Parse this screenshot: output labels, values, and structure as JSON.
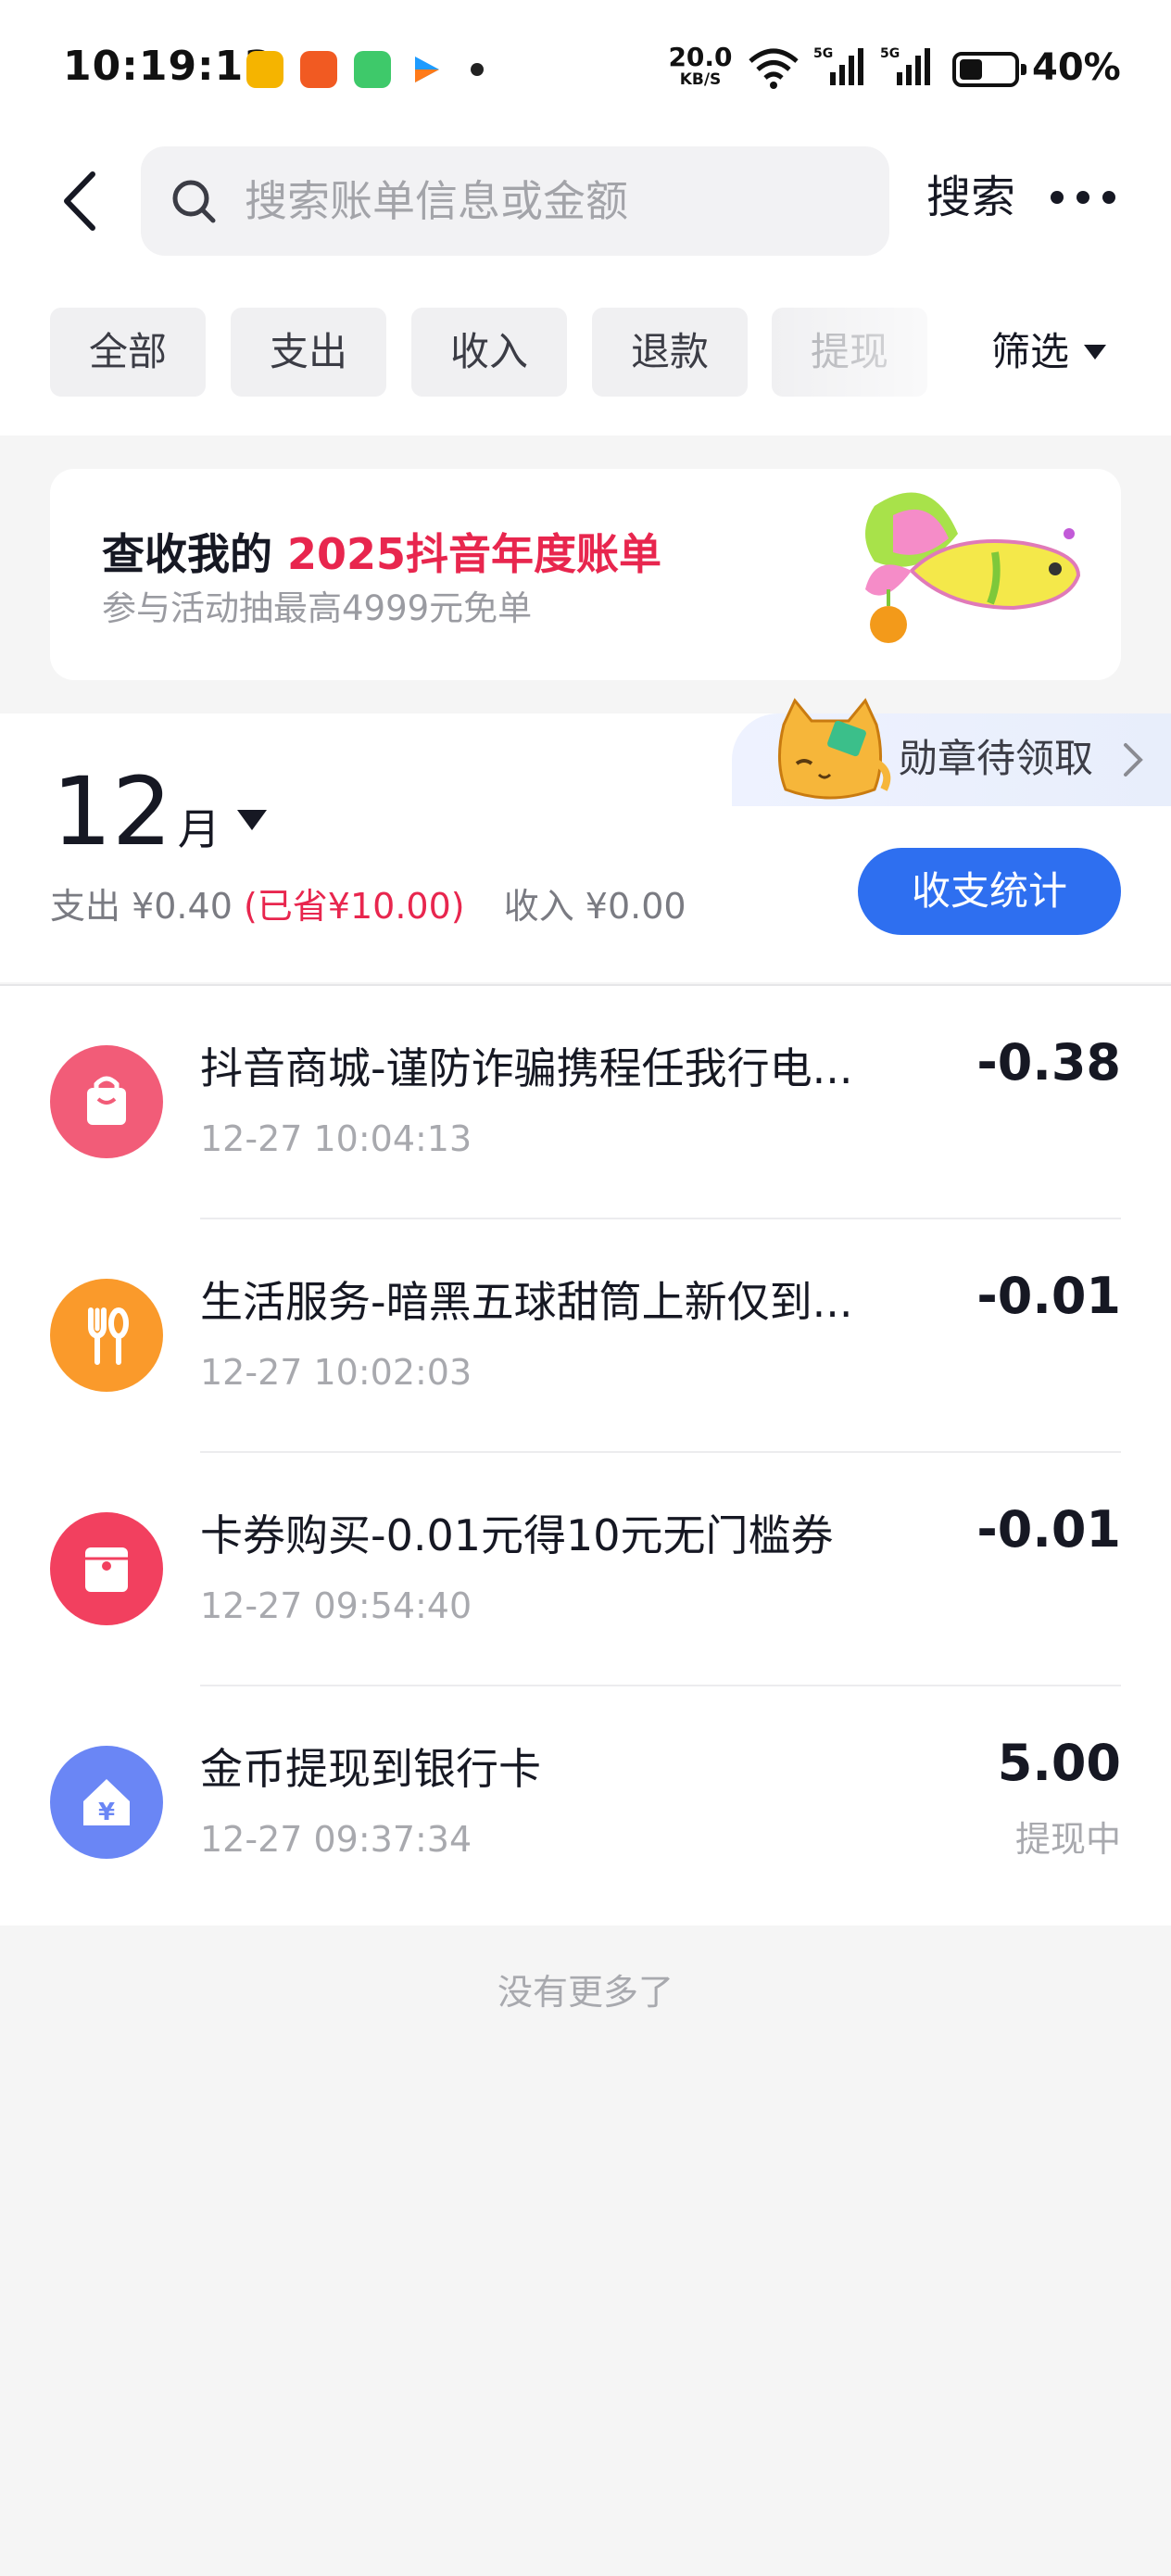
{
  "status_bar": {
    "time": "10:19:13",
    "net_speed": "20.0",
    "net_unit": "KB/S",
    "signal1": "5G",
    "signal2": "5G",
    "battery": "40%"
  },
  "header": {
    "search_placeholder": "搜索账单信息或金额",
    "search_button": "搜索"
  },
  "tabs": [
    "全部",
    "支出",
    "收入",
    "退款",
    "提现"
  ],
  "filter_label": "筛选",
  "banner": {
    "title_prefix": "查收我的",
    "title_highlight": "2025抖音年度账单",
    "subtitle": "参与活动抽最高4999元免单"
  },
  "badge_text": "勋章待领取",
  "month": {
    "number": "12",
    "unit": "月",
    "expense": "支出 ¥0.40",
    "saved": "(已省¥10.00)",
    "income": "收入 ¥0.00",
    "stats_button": "收支统计"
  },
  "transactions": [
    {
      "title": "抖音商城-谨防诈骗携程任我行电...",
      "time": "12-27 10:04:13",
      "amount": "-0.38",
      "status": "",
      "icon": "shopping-bag-icon",
      "color": "#f25c78"
    },
    {
      "title": "生活服务-暗黑五球甜筒上新仅到...",
      "time": "12-27 10:02:03",
      "amount": "-0.01",
      "status": "",
      "icon": "fork-spoon-icon",
      "color": "#fa9a2b"
    },
    {
      "title": "卡券购买-0.01元得10元无门槛券",
      "time": "12-27 09:54:40",
      "amount": "-0.01",
      "status": "",
      "icon": "coupon-icon",
      "color": "#f2405f"
    },
    {
      "title": "金币提现到银行卡",
      "time": "12-27 09:37:34",
      "amount": "5.00",
      "status": "提现中",
      "icon": "bank-card-icon",
      "color": "#6a86f5"
    }
  ],
  "footer_text": "没有更多了",
  "colors": {
    "accent_red": "#e8264e",
    "primary_blue": "#2e6ff0"
  }
}
